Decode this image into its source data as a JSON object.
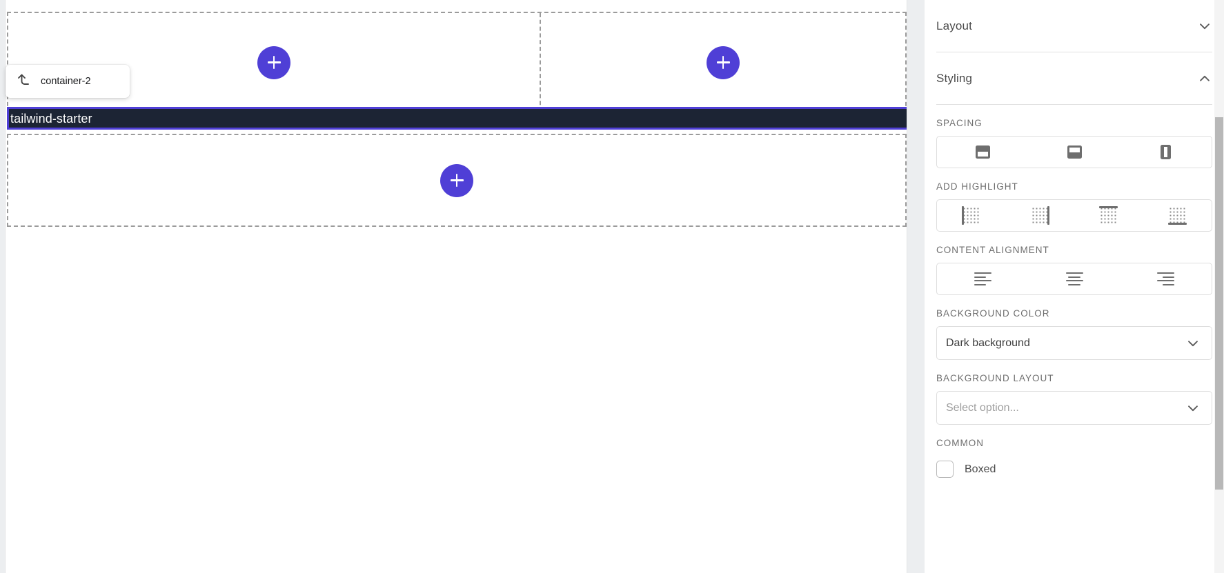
{
  "canvas": {
    "popover": {
      "icon": "arrow-turn-up-left-icon",
      "label": "container-2"
    },
    "selected_block": {
      "label": "tailwind-starter",
      "background_color": "#1c2434",
      "outline_color": "#4f3fd6"
    },
    "add_buttons": [
      {
        "name": "add-block-top-left",
        "glyph": "+"
      },
      {
        "name": "add-block-top-right",
        "glyph": "+"
      },
      {
        "name": "add-block-bottom",
        "glyph": "+"
      }
    ],
    "accent_color": "#4f3fd6",
    "dropzone_border_color": "#9b9b9b"
  },
  "panel": {
    "sections": [
      {
        "id": "layout",
        "title": "Layout",
        "expanded": false,
        "chevron": "chevron-down-icon"
      },
      {
        "id": "styling",
        "title": "Styling",
        "expanded": true,
        "chevron": "chevron-up-icon"
      }
    ],
    "styling": {
      "spacing": {
        "label": "SPACING",
        "options": [
          {
            "name": "padding-top-option",
            "icon": "padding-top-icon"
          },
          {
            "name": "padding-bottom-option",
            "icon": "padding-bottom-icon"
          },
          {
            "name": "padding-sides-option",
            "icon": "padding-sides-icon"
          }
        ]
      },
      "add_highlight": {
        "label": "ADD HIGHLIGHT",
        "options": [
          {
            "name": "highlight-left-option",
            "icon": "highlight-left-icon"
          },
          {
            "name": "highlight-right-option",
            "icon": "highlight-right-icon"
          },
          {
            "name": "highlight-top-option",
            "icon": "highlight-top-icon"
          },
          {
            "name": "highlight-bottom-option",
            "icon": "highlight-bottom-icon"
          }
        ]
      },
      "content_alignment": {
        "label": "CONTENT ALIGNMENT",
        "options": [
          {
            "name": "align-left-option",
            "icon": "align-left-icon"
          },
          {
            "name": "align-center-option",
            "icon": "align-center-icon"
          },
          {
            "name": "align-right-option",
            "icon": "align-right-icon"
          }
        ]
      },
      "background_color": {
        "label": "BACKGROUND COLOR",
        "value": "Dark background",
        "chevron": "chevron-down-icon"
      },
      "background_layout": {
        "label": "BACKGROUND LAYOUT",
        "value": "",
        "placeholder": "Select option...",
        "chevron": "chevron-down-icon"
      },
      "common": {
        "label": "COMMON",
        "checkbox": {
          "label": "Boxed",
          "checked": false
        }
      }
    }
  }
}
